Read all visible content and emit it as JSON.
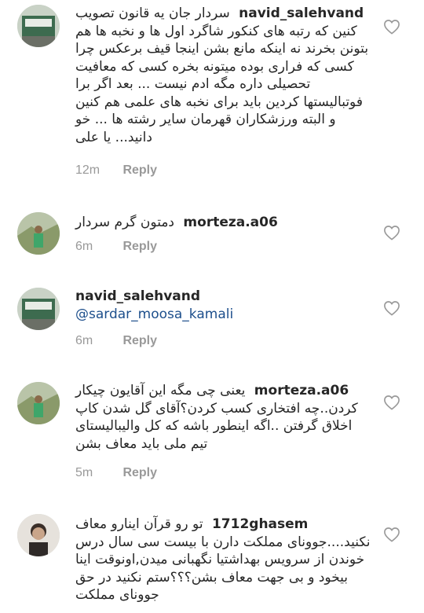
{
  "comments": [
    {
      "username": "navid_salehvand",
      "text": "سردار جان یه قانون تصویب کنین که رتبه های کنکور شاگرد اول ها و نخبه ها هم بتونن بخرند نه اینکه مانع بشن اینجا قیف برعکس چرا کسی که فراری بوده میتونه بخره کسی که معافیت تحصیلی داره  مگه ادم نیست ... بعد اگر برا فوتبالیستها کردین باید برای نخبه های علمی هم کنین  و البته ورزشکاران قهرمان سایر رشته ها ... خو دانید... یا علی",
      "time": "12m",
      "reply": "Reply"
    },
    {
      "username": "morteza.a06",
      "text": "دمتون گرم سردار",
      "time": "6m",
      "reply": "Reply"
    },
    {
      "username": "navid_salehvand",
      "mention": "@sardar_moosa_kamali",
      "time": "6m",
      "reply": "Reply"
    },
    {
      "username": "morteza.a06",
      "text": "یعنی چی مگه این آقایون چیکار کردن..چه افتخاری کسب کردن؟آقای گل شدن کاپ اخلاق گرفتن ..اگه اینطور باشه که کل والیبالیستای  تیم ملی باید معاف بشن",
      "time": "5m",
      "reply": "Reply"
    },
    {
      "username": "1712ghasem",
      "text": "تو رو قرآن اینارو معاف نکنید....جوونای مملکت دارن با بیست سی سال درس خوندن از سرویس بهداشتیا نگهبانی میدن,اونوقت اینا بیخود و بی جهت معاف بشن؟؟؟ستم نکنید در حق جوونای مملکت"
    }
  ],
  "icons": {
    "like": "heart-outline-icon",
    "avatar": "user-avatar"
  },
  "colors": {
    "text": "#262626",
    "meta": "#999999",
    "mention": "#1d4f8c"
  }
}
